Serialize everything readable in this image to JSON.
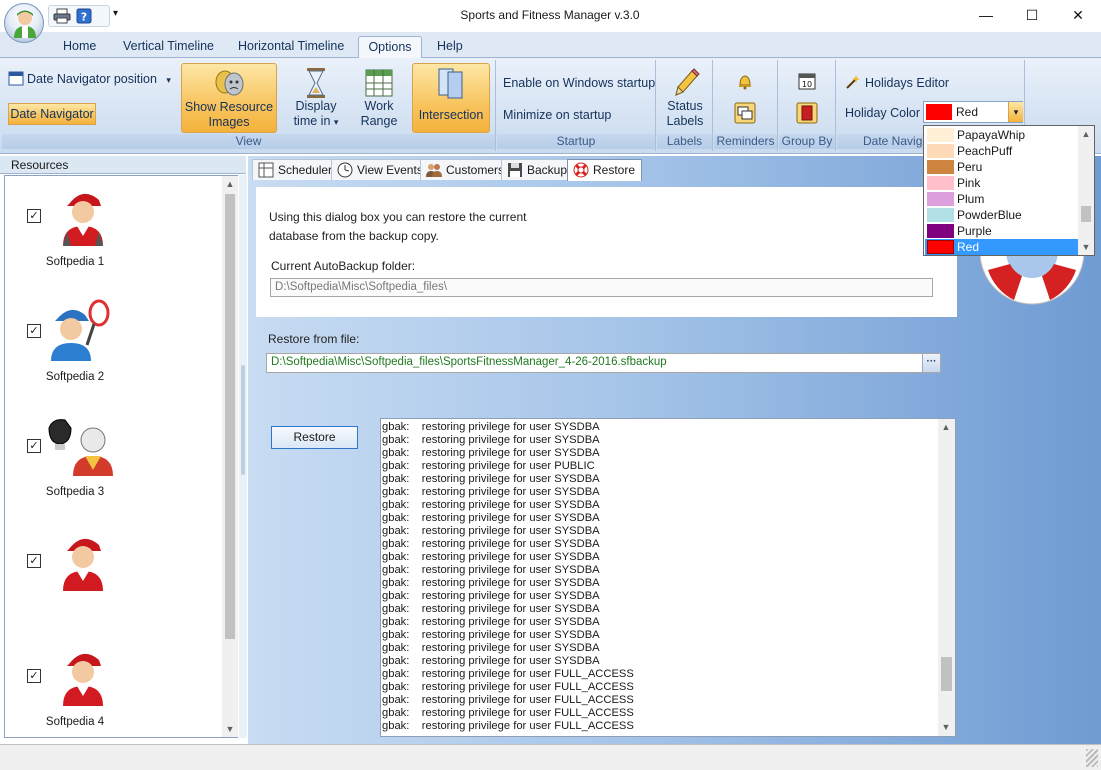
{
  "window": {
    "title": "Sports and Fitness Manager v.3.0",
    "min_glyph": "—",
    "max_glyph": "☐",
    "close_glyph": "✕"
  },
  "quick_access": {
    "dropdown_glyph": "▾"
  },
  "tabs": [
    {
      "label": "Home"
    },
    {
      "label": "Vertical Timeline"
    },
    {
      "label": "Horizontal Timeline"
    },
    {
      "label": "Options"
    },
    {
      "label": "Help"
    }
  ],
  "ribbon": {
    "date_navigator_position": "Date Navigator position",
    "date_navigator": "Date Navigator",
    "show_resource_images": [
      "Show Resource",
      "Images"
    ],
    "display_time_in": [
      "Display",
      "time in"
    ],
    "work_range": [
      "Work",
      "Range"
    ],
    "intersection": "Intersection",
    "group_view": "View",
    "enable_startup": "Enable on Windows startup",
    "minimize_startup": "Minimize on startup",
    "group_startup": "Startup",
    "status_labels": [
      "Status",
      "Labels"
    ],
    "group_labels": "Labels",
    "group_reminders": "Reminders",
    "group_by": "Group By",
    "holidays_editor": "Holidays Editor",
    "holiday_color": "Holiday Color",
    "group_date_nav": "Date Navig",
    "selected_color": {
      "name": "Red",
      "hex": "#ff0000"
    },
    "dropdown_glyph": "▾"
  },
  "color_options": [
    {
      "name": "PapayaWhip",
      "hex": "#ffefd5"
    },
    {
      "name": "PeachPuff",
      "hex": "#ffdab9"
    },
    {
      "name": "Peru",
      "hex": "#cd853f"
    },
    {
      "name": "Pink",
      "hex": "#ffc0cb"
    },
    {
      "name": "Plum",
      "hex": "#dda0dd"
    },
    {
      "name": "PowderBlue",
      "hex": "#b0e0e6"
    },
    {
      "name": "Purple",
      "hex": "#800080"
    },
    {
      "name": "Red",
      "hex": "#ff0000"
    }
  ],
  "resources": {
    "header": "Resources",
    "check_glyph": "✓",
    "collapse_glyph": "‹",
    "items": [
      {
        "name": "Softpedia 1",
        "checked": true
      },
      {
        "name": "Softpedia 2",
        "checked": true
      },
      {
        "name": "Softpedia 3",
        "checked": true
      },
      {
        "name": "",
        "checked": true
      },
      {
        "name": "Softpedia 4",
        "checked": true
      }
    ]
  },
  "doc_tabs": [
    {
      "label": "Scheduler"
    },
    {
      "label": "View Events"
    },
    {
      "label": "Customers"
    },
    {
      "label": "Backup"
    },
    {
      "label": "Restore"
    }
  ],
  "restore": {
    "intro_line1": "Using this dialog box you can restore the current",
    "intro_line2": "database from the backup copy.",
    "autobackup_label": "Current AutoBackup folder:",
    "autobackup_value": "D:\\Softpedia\\Misc\\Softpedia_files\\",
    "from_file_label": "Restore from file:",
    "from_file_value": "D:\\Softpedia\\Misc\\Softpedia_files\\SportsFitnessManager_4-26-2016.sfbackup",
    "browse_label": "···",
    "restore_button": "Restore",
    "log": [
      "gbak:    restoring privilege for user SYSDBA",
      "gbak:    restoring privilege for user SYSDBA",
      "gbak:    restoring privilege for user SYSDBA",
      "gbak:    restoring privilege for user PUBLIC",
      "gbak:    restoring privilege for user SYSDBA",
      "gbak:    restoring privilege for user SYSDBA",
      "gbak:    restoring privilege for user SYSDBA",
      "gbak:    restoring privilege for user SYSDBA",
      "gbak:    restoring privilege for user SYSDBA",
      "gbak:    restoring privilege for user SYSDBA",
      "gbak:    restoring privilege for user SYSDBA",
      "gbak:    restoring privilege for user SYSDBA",
      "gbak:    restoring privilege for user SYSDBA",
      "gbak:    restoring privilege for user SYSDBA",
      "gbak:    restoring privilege for user SYSDBA",
      "gbak:    restoring privilege for user SYSDBA",
      "gbak:    restoring privilege for user SYSDBA",
      "gbak:    restoring privilege for user SYSDBA",
      "gbak:    restoring privilege for user SYSDBA",
      "gbak:    restoring privilege for user FULL_ACCESS",
      "gbak:    restoring privilege for user FULL_ACCESS",
      "gbak:    restoring privilege for user FULL_ACCESS",
      "gbak:    restoring privilege for user FULL_ACCESS",
      "gbak:    restoring privilege for user FULL_ACCESS"
    ]
  },
  "scroll_glyphs": {
    "up": "▲",
    "down": "▼",
    "left": "◀",
    "right": "▶"
  }
}
